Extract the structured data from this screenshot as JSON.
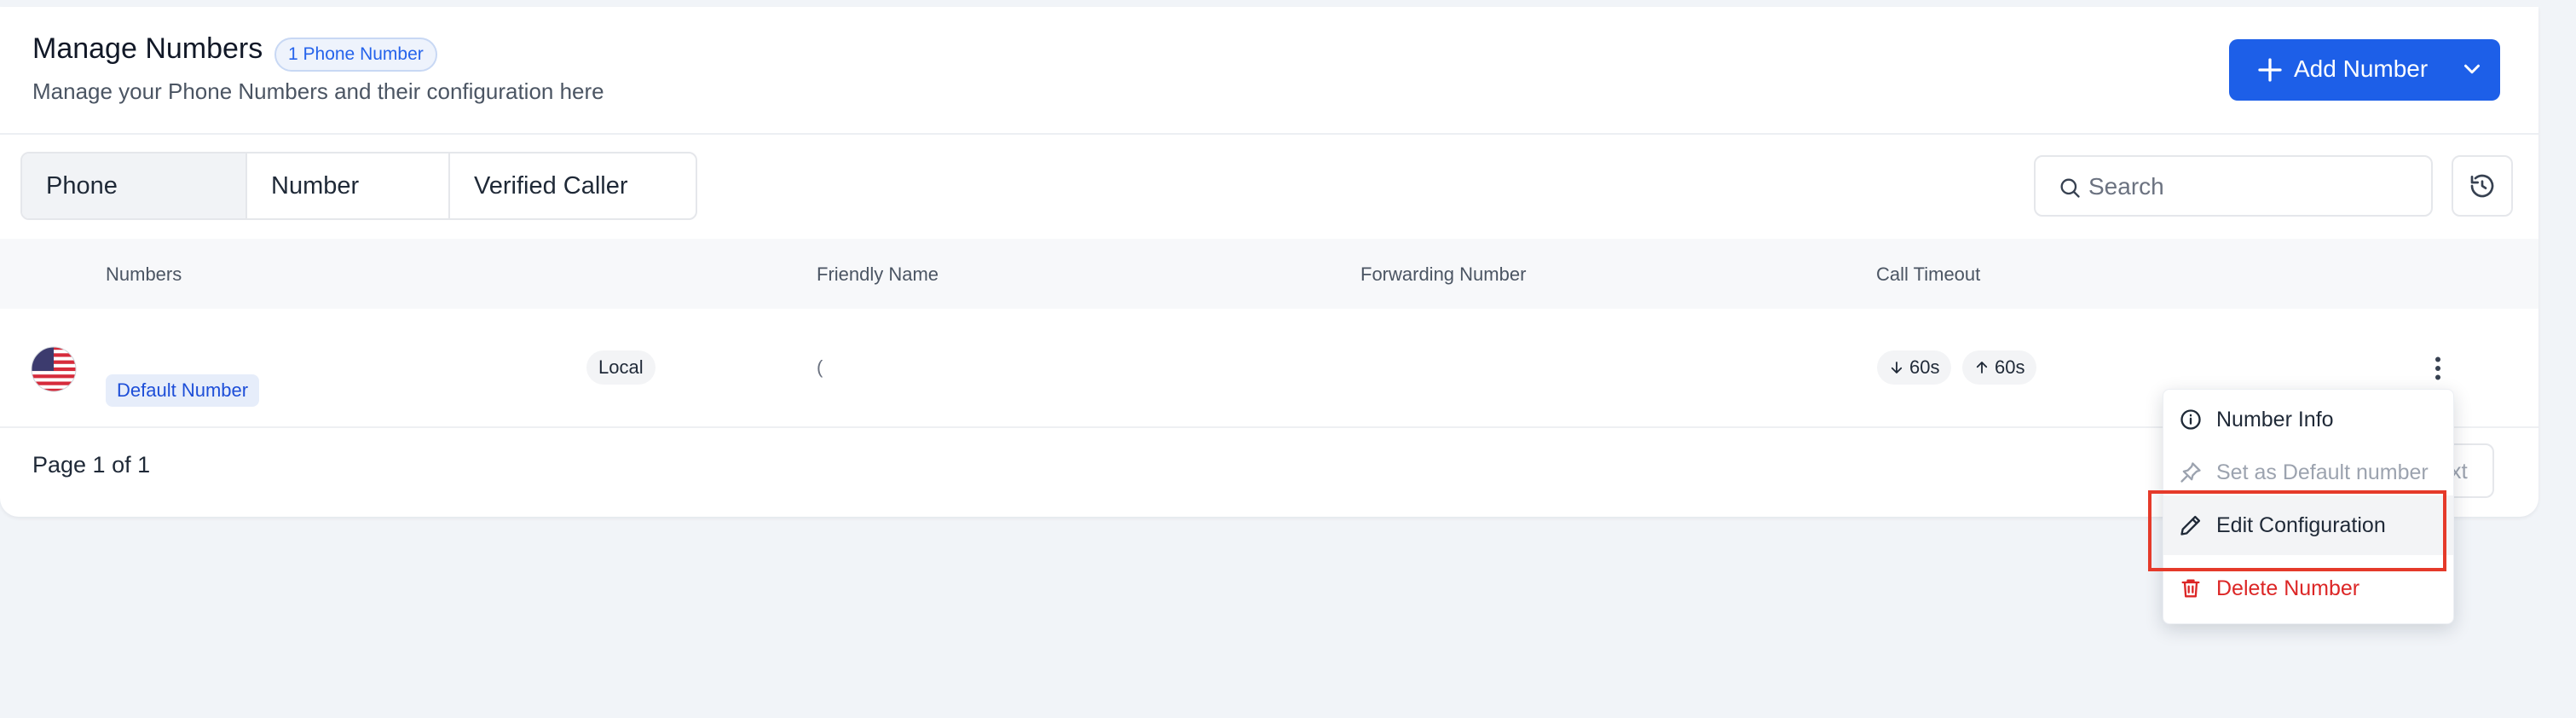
{
  "header": {
    "title": "Manage Numbers",
    "count_badge": "1 Phone Number",
    "subtitle": "Manage your Phone Numbers and their configuration here",
    "add_button_label": "Add Number"
  },
  "tabs": [
    {
      "label": "Phone Numbers",
      "active": true
    },
    {
      "label": "Number Pools",
      "active": false
    },
    {
      "label": "Verified Caller IDs",
      "active": false
    }
  ],
  "search": {
    "placeholder": "Search",
    "value": ""
  },
  "table": {
    "columns": [
      "Numbers",
      "Friendly Name",
      "Forwarding Number",
      "Call Timeout"
    ],
    "rows": [
      {
        "default_badge": "Default Number",
        "type": "Local",
        "friendly_name_fragment": "(",
        "inbound_timeout": "60s",
        "outbound_timeout": "60s"
      }
    ]
  },
  "pagination": {
    "text": "Page 1 of 1",
    "next_label": "Next"
  },
  "row_menu": {
    "items": [
      {
        "label": "Number Info",
        "icon": "info-icon",
        "enabled": true
      },
      {
        "label": "Set as Default number",
        "icon": "pin-icon",
        "enabled": false
      },
      {
        "label": "Edit Configuration",
        "icon": "pencil-icon",
        "enabled": true,
        "highlighted": true
      },
      {
        "label": "Delete Number",
        "icon": "trash-icon",
        "enabled": true,
        "destructive": true
      }
    ]
  },
  "colors": {
    "accent": "#1d5fe8",
    "badge_text": "#2563eb",
    "danger": "#dc2626",
    "highlight_border": "#e53a2a",
    "background": "#f1f4f8"
  }
}
